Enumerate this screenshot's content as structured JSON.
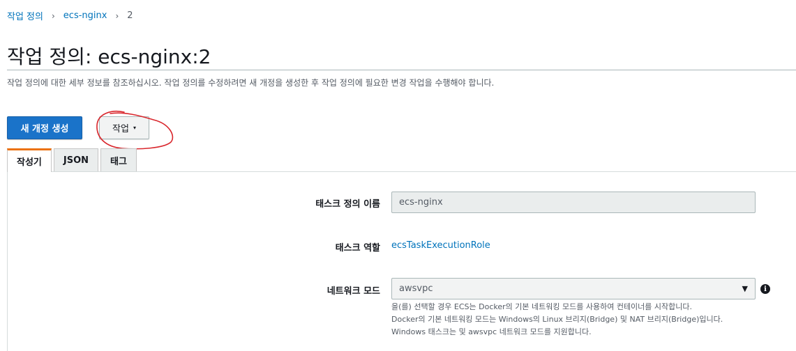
{
  "breadcrumb": {
    "items": [
      "작업 정의",
      "ecs-nginx"
    ],
    "current": "2",
    "separator": "›"
  },
  "page": {
    "title": "작업 정의: ecs-nginx:2",
    "description": "작업 정의에 대한 세부 정보를 참조하십시오. 작업 정의를 수정하려면 새 개정을 생성한 후 작업 정의에 필요한 변경 작업을 수행해야 합니다."
  },
  "buttons": {
    "create_revision": "새 개정 생성",
    "actions": "작업",
    "actions_caret": "▾"
  },
  "tabs": [
    {
      "label": "작성기",
      "active": true
    },
    {
      "label": "JSON",
      "active": false
    },
    {
      "label": "태그",
      "active": false
    }
  ],
  "form": {
    "task_def_name": {
      "label": "태스크 정의 이름",
      "value": "ecs-nginx"
    },
    "task_role": {
      "label": "태스크 역할",
      "value": "ecsTaskExecutionRole"
    },
    "network_mode": {
      "label": "네트워크 모드",
      "value": "awsvpc",
      "info_icon": "i",
      "help": [
        "을(를) 선택할 경우 ECS는 Docker의 기본 네트워킹 모드를 사용하여 컨테이너를 시작합니다.",
        "Docker의 기본 네트워킹 모드는 Windows의 Linux 브리지(Bridge) 및 NAT 브리지(Bridge)입니다.",
        "Windows 태스크는 및 awsvpc 네트워크 모드를 지원합니다."
      ]
    }
  },
  "colors": {
    "link": "#0073bb",
    "primary_button": "#1a73c9",
    "active_tab_accent": "#ec7211",
    "annotation": "#d9262c"
  }
}
